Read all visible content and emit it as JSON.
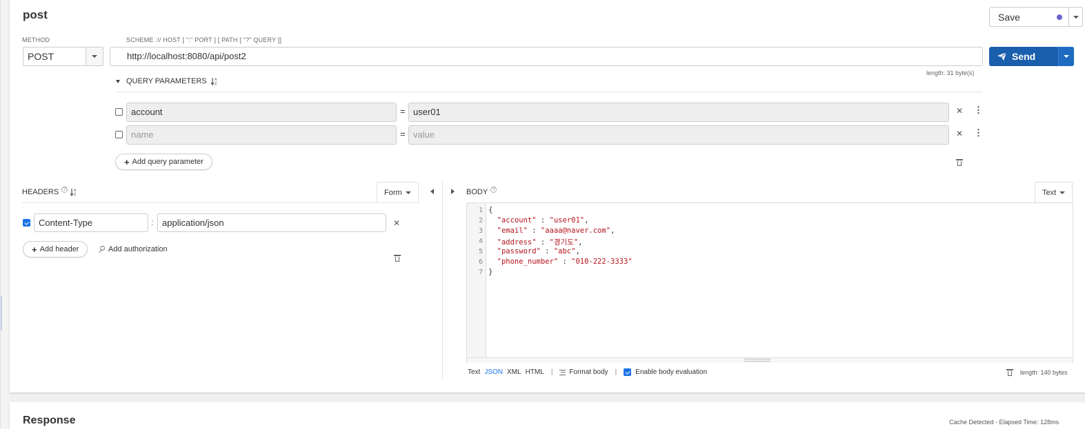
{
  "request": {
    "title": "post",
    "save_label": "Save",
    "method_label": "METHOD",
    "method_value": "POST",
    "scheme_label": "SCHEME :// HOST [ \":\" PORT ] [ PATH [ \"?\" QUERY ]]",
    "url": "http://localhost:8080/api/post2",
    "url_length": "length: 31 byte(s)",
    "send_label": "Send"
  },
  "query_params": {
    "heading": "QUERY PARAMETERS",
    "rows": [
      {
        "name": "account",
        "value": "user01",
        "checked": false
      },
      {
        "name_placeholder": "name",
        "value_placeholder": "value",
        "checked": false
      }
    ],
    "add_label": "Add query parameter"
  },
  "headers": {
    "heading": "HEADERS",
    "mode": "Form",
    "rows": [
      {
        "name": "Content-Type",
        "value": "application/json",
        "checked": true
      }
    ],
    "add_label": "Add header",
    "auth_label": "Add authorization"
  },
  "body": {
    "heading": "BODY",
    "mode": "Text",
    "lines": [
      {
        "n": "1",
        "t": "{"
      },
      {
        "n": "2",
        "k": "  \"account\"",
        "v": "\"user01\"",
        "c": ","
      },
      {
        "n": "3",
        "k": "  \"email\"",
        "v": "\"aaaa@naver.com\"",
        "c": ","
      },
      {
        "n": "4",
        "k": "  \"address\"",
        "v": "\"경기도\"",
        "c": ","
      },
      {
        "n": "5",
        "k": "  \"password\"",
        "v": "\"abc\"",
        "c": ","
      },
      {
        "n": "6",
        "k": "  \"phone_number\"",
        "v": "\"010-222-3333\"",
        "c": ""
      },
      {
        "n": "7",
        "t": "}"
      }
    ],
    "formats": [
      "Text",
      "JSON",
      "XML",
      "HTML"
    ],
    "selected_format": "JSON",
    "format_body_label": "Format body",
    "enable_eval_label": "Enable body evaluation",
    "enable_eval_checked": true,
    "length": "length: 140 bytes"
  },
  "response": {
    "title": "Response",
    "status": "Cache Detected - Elapsed Time: 128ms"
  }
}
